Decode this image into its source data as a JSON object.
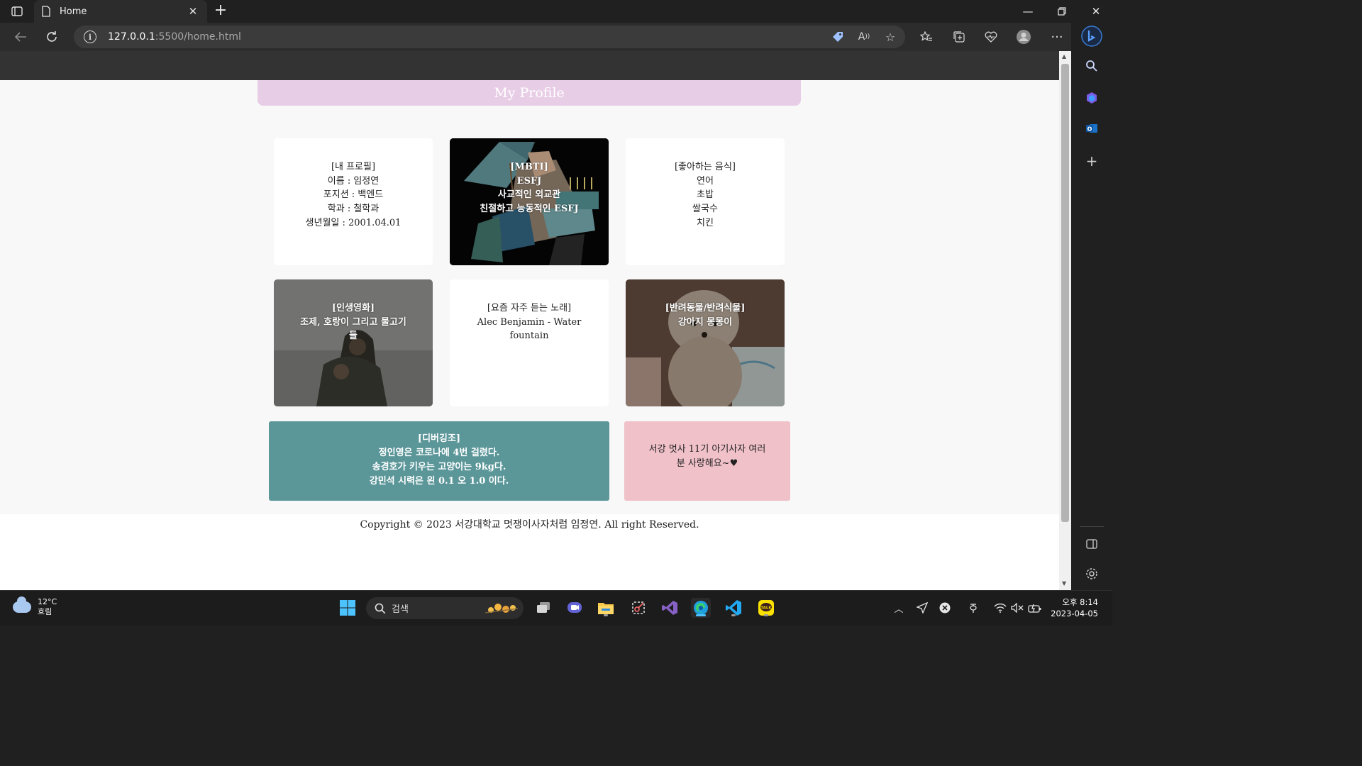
{
  "browser": {
    "tab_title": "Home",
    "url_host": "127.0.0.1",
    "url_path": ":5500/home.html"
  },
  "page": {
    "title": "My Profile",
    "cards": [
      {
        "lines": [
          "[내 프로필]",
          "이름 : 임정연",
          "포지션 : 백엔드",
          "학과 : 철학과",
          "생년월일 : 2001.04.01"
        ]
      },
      {
        "lines": [
          "[MBTI]",
          "ESFJ",
          "사교적인 외교관",
          "친절하고 능동적인 ESFJ"
        ]
      },
      {
        "lines": [
          "[좋아하는 음식]",
          "연어",
          "초밥",
          "쌀국수",
          "치킨"
        ]
      },
      {
        "lines": [
          "[인생영화]",
          "조제, 호랑이 그리고 물고기",
          "들"
        ]
      },
      {
        "lines": [
          "[요즘 자주 듣는 노래]",
          "Alec Benjamin - Water",
          "fountain"
        ]
      },
      {
        "lines": [
          "[반려동물/반려식물]",
          "강아지 몽몽이"
        ]
      }
    ],
    "debugging_card": {
      "lines": [
        "[디버깅조]",
        "정인영은 코로나에 4번 걸렸다.",
        "송경호가 키우는 고양이는 9kg다.",
        "강민석 시력은 왼 0.1 오 1.0 이다."
      ]
    },
    "message_card": {
      "lines": [
        "서강 멋사 11기 아기사자 여러",
        "분 사랑해요~♥"
      ]
    },
    "footer": "Copyright © 2023 서강대학교 멋쟁이사자처럼 임정연. All right Reserved."
  },
  "taskbar": {
    "weather_temp": "12°C",
    "weather_cond": "흐림",
    "search_placeholder": "검색",
    "time": "오후 8:14",
    "date": "2023-04-05"
  },
  "colors": {
    "title_bar": "#e8cde6",
    "debug_card": "#5b9699",
    "message_card": "#f0c1c9",
    "site_header": "#333333"
  }
}
